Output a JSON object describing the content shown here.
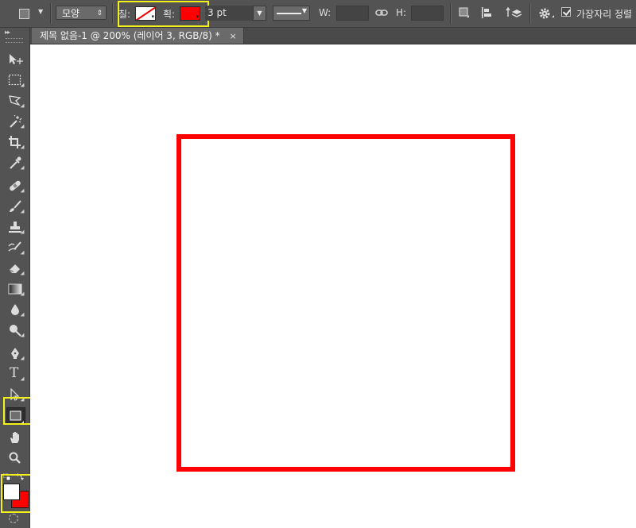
{
  "optionsBar": {
    "mode": "모양",
    "fill_label": "칠:",
    "stroke_label": "획:",
    "stroke_width": "3 pt",
    "w_label": "W:",
    "h_label": "H:",
    "align_edges_label": "가장자리 정렬",
    "fill_color": "#ffffff",
    "stroke_color": "#ff0000"
  },
  "document": {
    "tab_title": "제목 없음-1 @ 200% (레이어 3, RGB/8) *",
    "close_symbol": "×"
  },
  "tools": {
    "items": [
      "move-tool",
      "rectangular-marquee-tool",
      "polygonal-lasso-tool",
      "magic-wand-tool",
      "crop-tool",
      "eyedropper-tool",
      "spot-healing-brush-tool",
      "brush-tool",
      "clone-stamp-tool",
      "history-brush-tool",
      "eraser-tool",
      "gradient-tool",
      "blur-tool",
      "dodge-tool",
      "pen-tool",
      "type-tool",
      "path-selection-tool",
      "rectangle-tool",
      "hand-tool",
      "zoom-tool"
    ],
    "type_glyph": "T",
    "foreground_color": "#ffffff",
    "background_color": "#ff0000"
  },
  "canvas": {
    "shape": "rectangle",
    "stroke_color": "#ff0000"
  }
}
